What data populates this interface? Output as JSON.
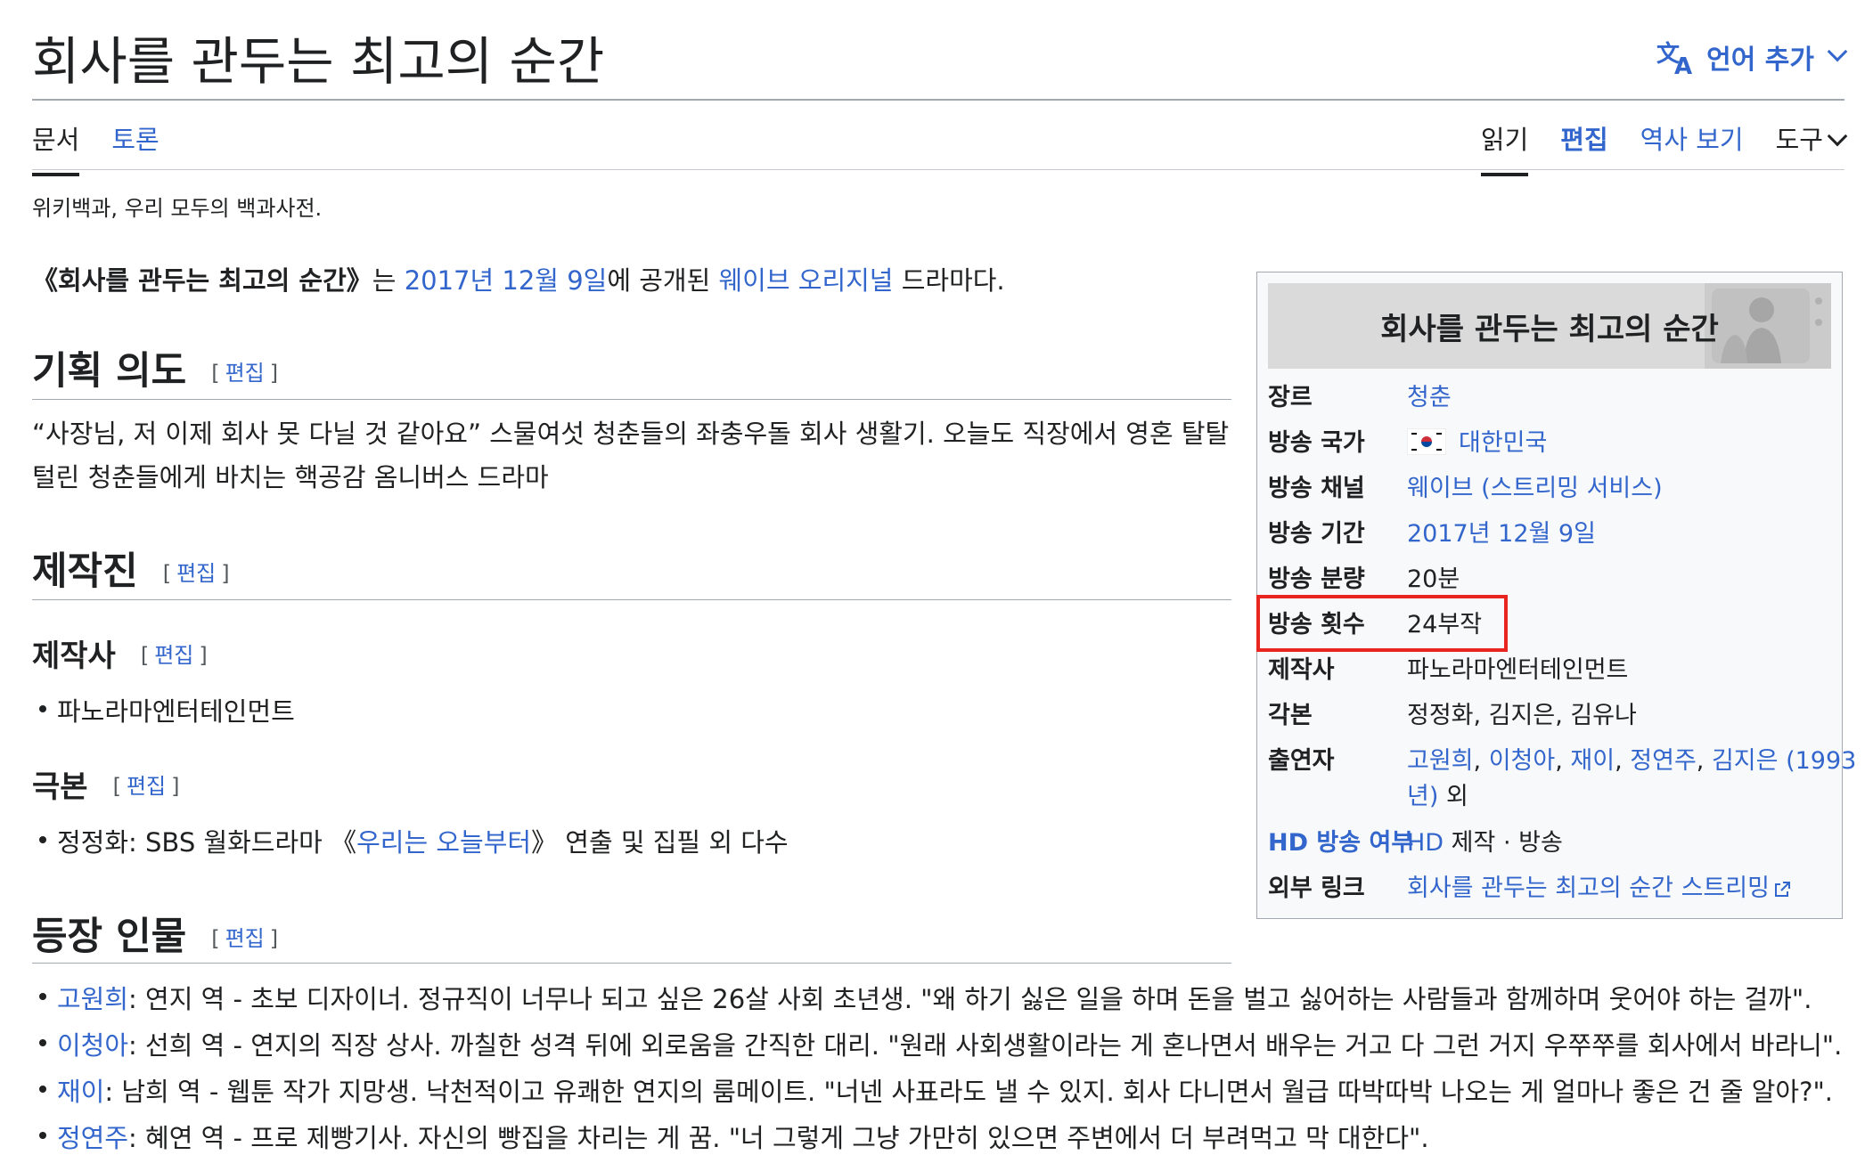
{
  "page": {
    "title": "회사를 관두는 최고의 순간",
    "language_button": "언어 추가",
    "tabs_left": [
      "문서",
      "토론"
    ],
    "tabs_right": {
      "read": "읽기",
      "edit": "편집",
      "history": "역사 보기",
      "tools": "도구"
    },
    "tagline": "위키백과, 우리 모두의 백과사전."
  },
  "intro": {
    "title_quoted": "《회사를 관두는 최고의 순간》",
    "t1": "는 ",
    "date_link": "2017년 12월 9일",
    "t2": "에 공개된 ",
    "original_link": "웨이브 오리지널",
    "t3": " 드라마다."
  },
  "edit_label": "편집",
  "sections": {
    "planning": {
      "heading": "기획 의도",
      "text": "“사장님, 저 이제 회사 못 다닐 것 같아요” 스물여섯 청춘들의 좌충우돌 회사 생활기. 오늘도 직장에서 영혼 탈탈 털린 청춘들에게 바치는 핵공감 옴니버스 드라마"
    },
    "staff": {
      "heading": "제작진"
    },
    "producer": {
      "heading": "제작사",
      "items": [
        "파노라마엔터테인먼트"
      ]
    },
    "script": {
      "heading": "극본",
      "item_prefix": "정정화: SBS 월화드라마 《",
      "item_link": "우리는 오늘부터",
      "item_suffix": "》 연출 및 집필 외 다수"
    },
    "characters": {
      "heading": "등장 인물",
      "items": [
        {
          "name": "고원희",
          "text": ": 연지 역 - 초보 디자이너. 정규직이 너무나 되고 싶은 26살 사회 초년생. \"왜 하기 싫은 일을 하며 돈을 벌고 싫어하는 사람들과 함께하며 웃어야 하는 걸까\"."
        },
        {
          "name": "이청아",
          "text": ": 선희 역 - 연지의 직장 상사. 까칠한 성격 뒤에 외로움을 간직한 대리. \"원래 사회생활이라는 게 혼나면서 배우는 거고 다 그런 거지 우쭈쭈를 회사에서 바라니\"."
        },
        {
          "name": "재이",
          "text": ": 남희 역 - 웹툰 작가 지망생. 낙천적이고 유쾌한 연지의 룸메이트. \"너넨 사표라도 낼 수 있지. 회사 다니면서 월급 따박따박 나오는 게 얼마나 좋은 건 줄 알아?\"."
        },
        {
          "name": "정연주",
          "text": ": 혜연 역 - 프로 제빵기사. 자신의 빵집을 차리는 게 꿈. \"너 그렇게 그냥 가만히 있으면 주변에서 더 부려먹고 막 대한다\"."
        }
      ]
    }
  },
  "infobox": {
    "title": "회사를 관두는 최고의 순간",
    "genre_label": "장르",
    "genre": "청춘",
    "country_label": "방송 국가",
    "country": "대한민국",
    "channel_label": "방송 채널",
    "channel": "웨이브 (스트리밍 서비스)",
    "period_label": "방송 기간",
    "period": "2017년 12월 9일",
    "runtime_label": "방송 분량",
    "runtime": "20분",
    "episodes_label": "방송 횟수",
    "episodes": "24부작",
    "producer_label": "제작사",
    "producer": "파노라마엔터테인먼트",
    "writer_label": "각본",
    "writer": "정정화, 김지은, 김유나",
    "cast_label": "출연자",
    "cast": [
      "고원희",
      "이청아",
      "재이",
      "정연주",
      "김지은 (1993",
      "년)"
    ],
    "cast_suffix": " 외",
    "hd_label_link": "HD",
    "hd_label_rest": " 방송 여부",
    "hd_value_link": "HD",
    "hd_value_rest": " 제작 · 방송",
    "external_label": "외부 링크",
    "external": "회사를 관두는 최고의 순간 스트리밍",
    "comma": ", "
  },
  "colors": {
    "link": "#3366cc",
    "highlight": "#e8251f",
    "text": "#202122"
  }
}
